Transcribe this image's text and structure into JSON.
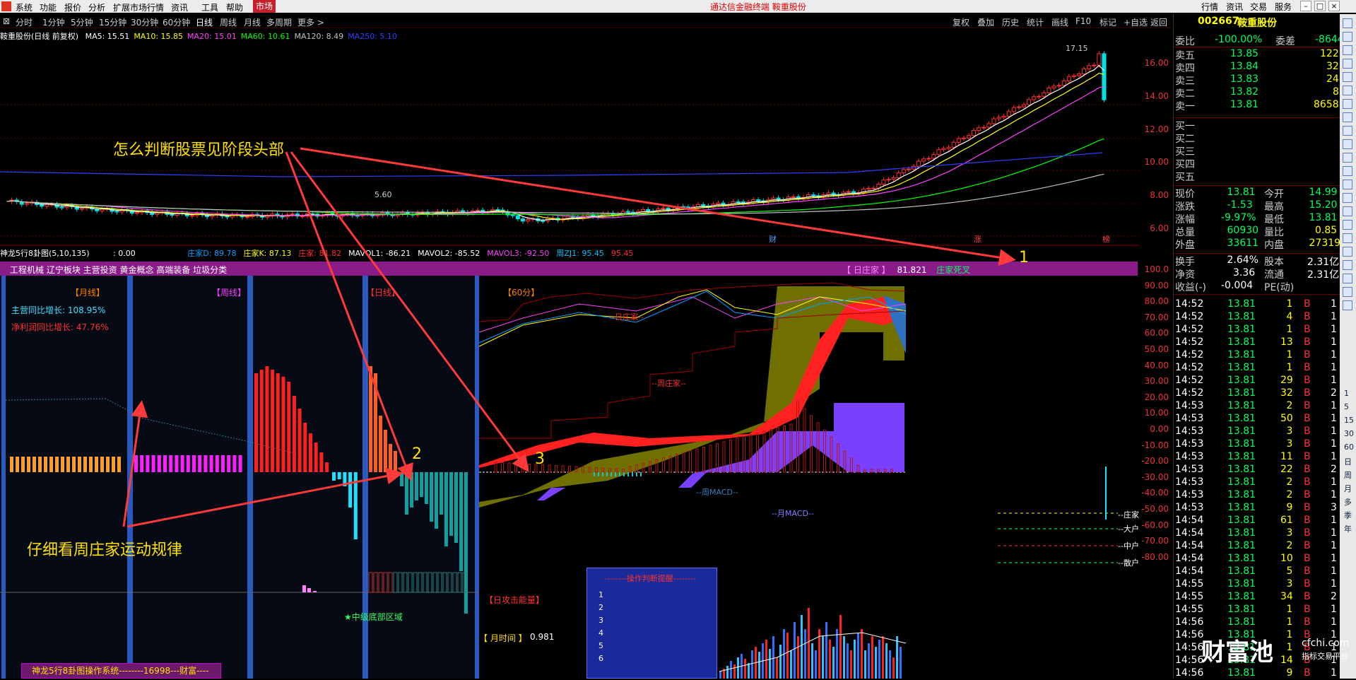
{
  "menubar": {
    "items": [
      "系统",
      "功能",
      "报价",
      "分析",
      "扩展市场行情",
      "资讯",
      "工具",
      "帮助"
    ],
    "active": "市场",
    "title": "通达信金融终端  鞍重股份",
    "right_buttons": [
      "行情",
      "资讯",
      "交易",
      "服务"
    ]
  },
  "periods": {
    "items": [
      "分时",
      "1分钟",
      "5分钟",
      "15分钟",
      "30分钟",
      "60分钟",
      "日线",
      "周线",
      "月线",
      "多周期",
      "更多 >"
    ],
    "selected": "日线",
    "right": [
      "复权",
      "叠加",
      "历史",
      "统计",
      "画线",
      "F10",
      "标记",
      "+自选",
      "返回"
    ]
  },
  "chart": {
    "name": "鞍重股份(日线 前复权)",
    "ma": [
      {
        "label": "MA5: 15.51",
        "color": "#ffffff"
      },
      {
        "label": "MA10: 15.85",
        "color": "#ffff00"
      },
      {
        "label": "MA20: 15.01",
        "color": "#ff40ff"
      },
      {
        "label": "MA60: 10.61",
        "color": "#00ff00"
      },
      {
        "label": "MA120: 8.49",
        "color": "#c0c0c0"
      },
      {
        "label": "MA250: 5.10",
        "color": "#3040ff"
      }
    ],
    "y_ticks": [
      "16.00",
      "14.00",
      "12.00",
      "10.00",
      "8.00",
      "6.00"
    ],
    "high_label": "17.15",
    "low_label": "5.60",
    "markers": [
      "财",
      "涨",
      "榜"
    ]
  },
  "sub_legend": {
    "title": "神龙5行8卦图(5,10,135)",
    "value": ": 0.00",
    "items": [
      {
        "label": "庄家D: 89.78",
        "color": "#00a0ff"
      },
      {
        "label": "庄家K: 87.13",
        "color": "#ffff00"
      },
      {
        "label": "庄家: 81.82",
        "color": "#ff3030"
      },
      {
        "label": "MAVOL1: -86.21",
        "color": "#ffffff"
      },
      {
        "label": "MAVOL2: -85.52",
        "color": "#ffffff"
      },
      {
        "label": "MAVOL3: -92.50",
        "color": "#ff40ff"
      },
      {
        "label": "周ZJ1: 95.45",
        "color": "#00c0ff"
      },
      {
        "label": "95.45",
        "color": "#ff3030"
      }
    ]
  },
  "purple_bar": {
    "sectors": "工程机械 辽宁板块 主营投资 黄金概念 高端装备 垃圾分类",
    "daily_label": "【 日庄家 】",
    "daily_value": "81.821",
    "signal": "庄家死叉"
  },
  "panels": {
    "month": "【月线】",
    "week": "【周线】",
    "day": "【日线】",
    "min60": "【60分】",
    "revenue": "主营同比增长: 108.95%",
    "profit": "净利润同比增长: 47.76%",
    "bottom_zone": "★中级底部区域",
    "energy": "【日攻击能量】",
    "month_time_label": "【 月时间 】",
    "month_time_value": "0.981"
  },
  "macd": {
    "labels": [
      "日庄家",
      "周庄家",
      "周MACD",
      "月MACD"
    ],
    "levels": [
      "庄家",
      "大户",
      "中户",
      "散户"
    ]
  },
  "operation_box": {
    "title": "--------操作判断提醒--------",
    "items": [
      "1",
      "2",
      "3",
      "4",
      "5",
      "6"
    ]
  },
  "sub_y_ticks": [
    "100.0",
    "90.00",
    "80.00",
    "70.00",
    "60.00",
    "50.00",
    "40.00",
    "30.00",
    "20.00",
    "10.00",
    "0.00",
    "-10.00",
    "-20.00",
    "-30.00",
    "-40.00",
    "-50.00",
    "-60.00",
    "-70.00",
    "-80.00"
  ],
  "annotations": {
    "top": "怎么判断股票见阶段头部",
    "bottom": "仔细看周庄家运动规律",
    "n1": "1",
    "n2": "2",
    "n3": "3"
  },
  "bottom_title": "神龙5行8卦图操作系统--------16998---财富----",
  "quote": {
    "code": "002667",
    "name": "鞍重股份",
    "weibi_label": "委比",
    "weibi": "-100.00%",
    "weicha_label": "委差",
    "weicha": "-8644",
    "sells": [
      {
        "label": "卖五",
        "price": "13.85",
        "vol": "122"
      },
      {
        "label": "卖四",
        "price": "13.84",
        "vol": "32"
      },
      {
        "label": "卖三",
        "price": "13.83",
        "vol": "24"
      },
      {
        "label": "卖二",
        "price": "13.82",
        "vol": "8"
      },
      {
        "label": "卖一",
        "price": "13.81",
        "vol": "8658"
      }
    ],
    "buys": [
      "买一",
      "买二",
      "买三",
      "买四",
      "买五"
    ],
    "stats": [
      {
        "l1": "现价",
        "v1": "13.81",
        "l2": "今开",
        "v2": "14.99"
      },
      {
        "l1": "涨跌",
        "v1": "-1.53",
        "l2": "最高",
        "v2": "15.20"
      },
      {
        "l1": "涨幅",
        "v1": "-9.97%",
        "l2": "最低",
        "v2": "13.81"
      },
      {
        "l1": "总量",
        "v1": "60930",
        "l2": "量比",
        "v2": "0.85"
      },
      {
        "l1": "外盘",
        "v1": "33611",
        "l2": "内盘",
        "v2": "27319"
      }
    ],
    "stats2": [
      {
        "l1": "换手",
        "v1": "2.64%",
        "l2": "股本",
        "v2": "2.31亿"
      },
      {
        "l1": "净资",
        "v1": "3.36",
        "l2": "流通",
        "v2": "2.31亿"
      },
      {
        "l1": "收益(-)",
        "v1": "-0.004",
        "l2": "PE(动)",
        "v2": ""
      }
    ],
    "ticks": [
      [
        "14:52",
        "13.81",
        "1",
        "B",
        "1"
      ],
      [
        "14:52",
        "13.81",
        "4",
        "B",
        "1"
      ],
      [
        "14:52",
        "13.81",
        "1",
        "B",
        "1"
      ],
      [
        "14:52",
        "13.81",
        "13",
        "B",
        "1"
      ],
      [
        "14:52",
        "13.81",
        "1",
        "B",
        "1"
      ],
      [
        "14:52",
        "13.81",
        "1",
        "B",
        "1"
      ],
      [
        "14:52",
        "13.81",
        "29",
        "B",
        "1"
      ],
      [
        "14:52",
        "13.81",
        "32",
        "B",
        "2"
      ],
      [
        "14:53",
        "13.81",
        "2",
        "B",
        "1"
      ],
      [
        "14:53",
        "13.81",
        "50",
        "B",
        "1"
      ],
      [
        "14:53",
        "13.81",
        "3",
        "B",
        "1"
      ],
      [
        "14:53",
        "13.81",
        "3",
        "B",
        "1"
      ],
      [
        "14:53",
        "13.81",
        "11",
        "B",
        "1"
      ],
      [
        "14:53",
        "13.81",
        "22",
        "B",
        "2"
      ],
      [
        "14:53",
        "13.81",
        "2",
        "B",
        "1"
      ],
      [
        "14:53",
        "13.81",
        "2",
        "B",
        "1"
      ],
      [
        "14:53",
        "13.81",
        "9",
        "B",
        "3"
      ],
      [
        "14:54",
        "13.81",
        "61",
        "B",
        "1"
      ],
      [
        "14:54",
        "13.81",
        "3",
        "B",
        "1"
      ],
      [
        "14:54",
        "13.81",
        "2",
        "B",
        "1"
      ],
      [
        "14:54",
        "13.81",
        "10",
        "B",
        "1"
      ],
      [
        "14:54",
        "13.81",
        "5",
        "B",
        "1"
      ],
      [
        "14:55",
        "13.81",
        "3",
        "B",
        "1"
      ],
      [
        "14:55",
        "13.81",
        "34",
        "B",
        "2"
      ],
      [
        "14:55",
        "13.81",
        "1",
        "B",
        "1"
      ],
      [
        "14:56",
        "13.81",
        "1",
        "B",
        "1"
      ],
      [
        "14:56",
        "13.81",
        "1",
        "B",
        "1"
      ],
      [
        "14:56",
        "13.81",
        "1",
        "B",
        "1"
      ],
      [
        "14:56",
        "13.81",
        "14",
        "B",
        "1"
      ],
      [
        "14:56",
        "13.81",
        "9",
        "B",
        "1"
      ]
    ]
  },
  "toolbar_labels": [
    "1",
    "5",
    "15",
    "30",
    "60",
    "日",
    "周",
    "月",
    "多",
    "季",
    "年"
  ],
  "watermark": {
    "brand": "财富池",
    "site": "cfchi.com",
    "slogan": "指标交易平台"
  }
}
